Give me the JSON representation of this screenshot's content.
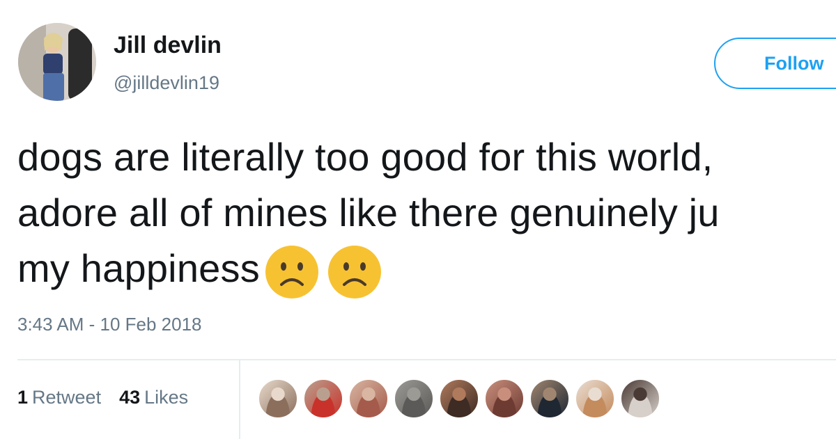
{
  "author": {
    "display_name": "Jill devlin",
    "handle": "@jilldevlin19",
    "avatar_icon": "profile-photo"
  },
  "follow_button": {
    "label": "Follow"
  },
  "tweet": {
    "lines": [
      "dogs are literally too good for this world,",
      "adore all of mines like there genuinely ju",
      "my happiness"
    ],
    "emojis": [
      "frowning-face-emoji",
      "frowning-face-emoji"
    ],
    "timestamp": "3:43 AM - 10 Feb 2018"
  },
  "stats": {
    "retweets": {
      "count": "1",
      "label": "Retweet"
    },
    "likes": {
      "count": "43",
      "label": "Likes"
    }
  },
  "likers": [
    {
      "name": "liker-avatar-1",
      "colors": [
        "#8b6f5c",
        "#e8d9cc"
      ]
    },
    {
      "name": "liker-avatar-2",
      "colors": [
        "#c9322b",
        "#b9a08e"
      ]
    },
    {
      "name": "liker-avatar-3",
      "colors": [
        "#a55b4b",
        "#d8b6a2"
      ]
    },
    {
      "name": "liker-avatar-4",
      "colors": [
        "#5b5a58",
        "#9c9a95"
      ]
    },
    {
      "name": "liker-avatar-5",
      "colors": [
        "#3d2b24",
        "#b07a5c"
      ]
    },
    {
      "name": "liker-avatar-6",
      "colors": [
        "#6e3b33",
        "#c98f7c"
      ]
    },
    {
      "name": "liker-avatar-7",
      "colors": [
        "#1f2733",
        "#a08670"
      ]
    },
    {
      "name": "liker-avatar-8",
      "colors": [
        "#c48b5d",
        "#e9ddd2"
      ]
    },
    {
      "name": "liker-avatar-9",
      "colors": [
        "#d7cfc9",
        "#4a3a35"
      ]
    }
  ],
  "colors": {
    "accent": "#1da1f2",
    "text": "#14171a",
    "muted": "#657786",
    "emoji_face": "#f7c232"
  }
}
